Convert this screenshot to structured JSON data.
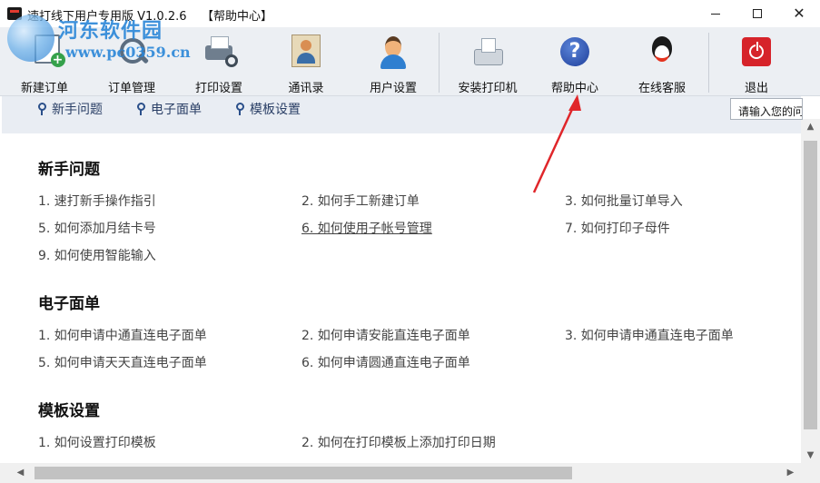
{
  "window": {
    "title": "速打线下用户专用版 V1.0.2.6    【帮助中心】",
    "minimize": "—",
    "maximize": "□",
    "close": "✕"
  },
  "watermark": {
    "main": "河东软件园",
    "url": "www.pc0359.cn"
  },
  "toolbar": {
    "items": [
      {
        "label": "新建订单",
        "icon": "new-order-icon"
      },
      {
        "label": "订单管理",
        "icon": "search-icon"
      },
      {
        "label": "打印设置",
        "icon": "printer-settings-icon"
      },
      {
        "label": "通讯录",
        "icon": "contacts-icon"
      },
      {
        "label": "用户设置",
        "icon": "user-icon"
      },
      {
        "label": "安装打印机",
        "icon": "install-printer-icon"
      },
      {
        "label": "帮助中心",
        "icon": "help-icon"
      },
      {
        "label": "在线客服",
        "icon": "qq-icon"
      },
      {
        "label": "退出",
        "icon": "power-icon"
      }
    ],
    "help_glyph": "?"
  },
  "search": {
    "value": "请输入您的问题"
  },
  "subnav": {
    "items": [
      "新手问题",
      "电子面单",
      "模板设置"
    ]
  },
  "sections": [
    {
      "title": "新手问题",
      "links": [
        "1. 速打新手操作指引",
        "2. 如何手工新建订单",
        "3. 如何批量订单导入",
        "5. 如何添加月结卡号",
        "6. 如何使用子帐号管理",
        "7. 如何打印子母件",
        "9. 如何使用智能输入"
      ]
    },
    {
      "title": "电子面单",
      "links": [
        "1. 如何申请中通直连电子面单",
        "2. 如何申请安能直连电子面单",
        "3. 如何申请申通直连电子面单",
        "5. 如何申请天天直连电子面单",
        "6. 如何申请圆通直连电子面单"
      ]
    },
    {
      "title": "模板设置",
      "links": [
        "1. 如何设置打印模板",
        "2. 如何在打印模板上添加打印日期"
      ]
    }
  ],
  "scrollbar": {
    "up": "▲",
    "down": "▼",
    "left": "◀",
    "right": "▶"
  },
  "colors": {
    "toolbar_bg": "#eceff3",
    "subnav_bg": "#e9edf3",
    "annotation_arrow": "#e0262a",
    "link_text": "#444444"
  }
}
